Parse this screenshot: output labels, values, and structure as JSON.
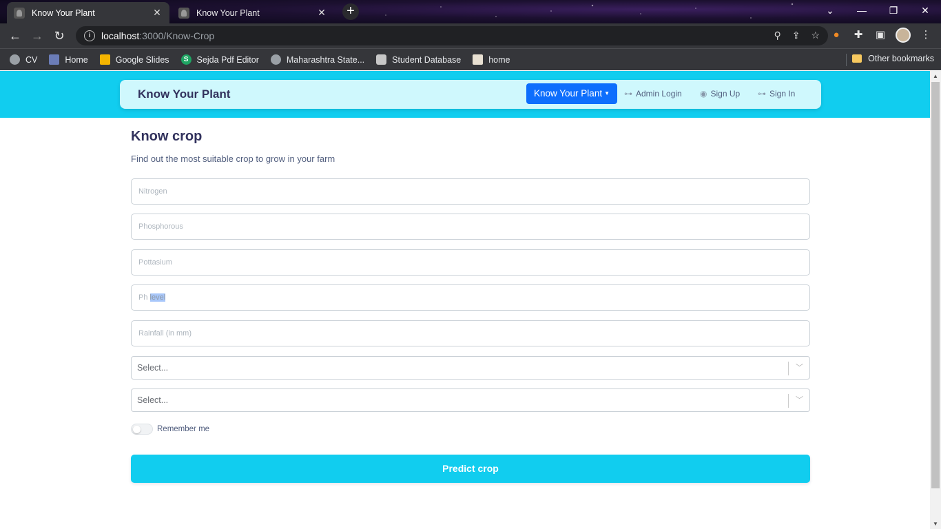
{
  "browser": {
    "tabs": [
      {
        "label": "Know Your Plant",
        "active": true
      },
      {
        "label": "Know Your Plant",
        "active": false
      }
    ],
    "url": {
      "host": "localhost",
      "path": ":3000/Know-Crop"
    },
    "bookmarks": [
      "CV",
      "Home",
      "Google Slides",
      "Sejda Pdf Editor",
      "Maharashtra State...",
      "Student Database",
      "home"
    ],
    "other_bookmarks": "Other bookmarks"
  },
  "navbar": {
    "brand": "Know Your Plant",
    "dropdown_label": "Know Your Plant",
    "links": {
      "admin_login": "Admin Login",
      "sign_up": "Sign Up",
      "sign_in": "Sign In"
    }
  },
  "form": {
    "title": "Know crop",
    "subtitle": "Find out the most suitable crop to grow in your farm",
    "fields": {
      "nitrogen": "Nitrogen",
      "phosphorous": "Phosphorous",
      "pottasium": "Pottasium",
      "ph_prefix": "Ph ",
      "ph_selected": "level",
      "rainfall": "Rainfall (in mm)"
    },
    "selects": {
      "select1": "Select...",
      "select2": "Select..."
    },
    "remember_label": "Remember me",
    "remember_on": false,
    "submit_label": "Predict crop"
  },
  "colors": {
    "accent": "#11cdef",
    "primary": "#0d6efd",
    "navbar_bg": "#cff8fd",
    "heading": "#32325d"
  }
}
